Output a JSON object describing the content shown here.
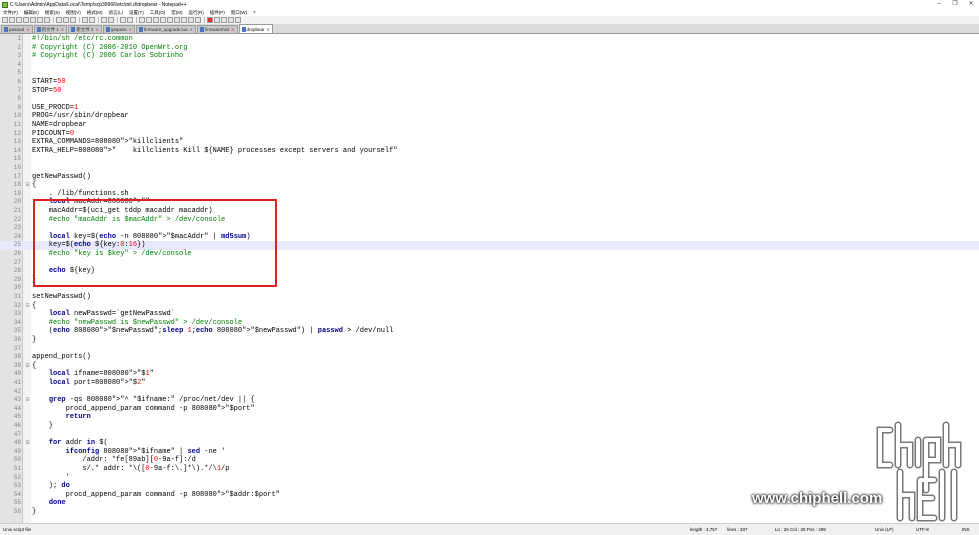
{
  "window": {
    "title": "C:\\Users\\Admin\\AppData\\Local\\Temp\\scp39966\\etc\\init.d\\dropbear - Notepad++",
    "controls": [
      "–",
      "❐",
      "✕"
    ]
  },
  "menu": [
    "文件(F)",
    "编辑(E)",
    "搜索(S)",
    "视图(V)",
    "格式(M)",
    "语言(L)",
    "设置(T)",
    "工具(O)",
    "宏(M)",
    "运行(R)",
    "插件(P)",
    "窗口(W)",
    "?"
  ],
  "tabs": [
    {
      "label": "passwd",
      "active": false
    },
    {
      "label": "新文件 1",
      "active": false
    },
    {
      "label": "新文件 2",
      "active": false
    },
    {
      "label": "getpass",
      "active": false
    },
    {
      "label": "firmware_upgrade.lua",
      "active": false
    },
    {
      "label": "firmwarehist",
      "active": false
    },
    {
      "label": "dropbear",
      "active": true
    }
  ],
  "code_lines": [
    {
      "n": "1",
      "fold": "",
      "text": "#!/bin/sh /etc/rc.common"
    },
    {
      "n": "2",
      "fold": "",
      "text": "# Copyright (C) 2006-2010 OpenWrt.org"
    },
    {
      "n": "3",
      "fold": "",
      "text": "# Copyright (C) 2006 Carlos Sobrinho"
    },
    {
      "n": "4",
      "fold": "",
      "text": ""
    },
    {
      "n": "5",
      "fold": "",
      "text": ""
    },
    {
      "n": "6",
      "fold": "",
      "text": "START=50"
    },
    {
      "n": "7",
      "fold": "",
      "text": "STOP=50"
    },
    {
      "n": "8",
      "fold": "",
      "text": ""
    },
    {
      "n": "9",
      "fold": "",
      "text": "USE_PROCD=1"
    },
    {
      "n": "10",
      "fold": "",
      "text": "PROG=/usr/sbin/dropbear"
    },
    {
      "n": "11",
      "fold": "",
      "text": "NAME=dropbear"
    },
    {
      "n": "12",
      "fold": "",
      "text": "PIDCOUNT=0"
    },
    {
      "n": "13",
      "fold": "",
      "text": "EXTRA_COMMANDS=\"killclients\""
    },
    {
      "n": "14",
      "fold": "",
      "text": "EXTRA_HELP=\"    killclients Kill ${NAME} processes except servers and yourself\""
    },
    {
      "n": "15",
      "fold": "",
      "text": ""
    },
    {
      "n": "16",
      "fold": "",
      "text": ""
    },
    {
      "n": "17",
      "fold": "",
      "text": "getNewPasswd()"
    },
    {
      "n": "18",
      "fold": "⊟",
      "text": "{"
    },
    {
      "n": "19",
      "fold": "",
      "text": "    . /lib/functions.sh"
    },
    {
      "n": "20",
      "fold": "",
      "text": "    local macAddr=\"\""
    },
    {
      "n": "21",
      "fold": "",
      "text": "    macAddr=$(uci_get tddp macaddr macaddr)"
    },
    {
      "n": "22",
      "fold": "",
      "text": "    #echo \"macAddr is $macAddr\" > /dev/console"
    },
    {
      "n": "23",
      "fold": "",
      "text": ""
    },
    {
      "n": "24",
      "fold": "",
      "text": "    local key=$(echo -n \"$macAddr\" | md5sum)"
    },
    {
      "n": "25",
      "fold": "",
      "text": "    key=$(echo ${key:0:16})"
    },
    {
      "n": "26",
      "fold": "",
      "text": "    #echo \"key is $key\" > /dev/console"
    },
    {
      "n": "27",
      "fold": "",
      "text": ""
    },
    {
      "n": "28",
      "fold": "",
      "text": "    echo ${key}"
    },
    {
      "n": "29",
      "fold": "",
      "text": "}"
    },
    {
      "n": "30",
      "fold": "",
      "text": ""
    },
    {
      "n": "31",
      "fold": "",
      "text": "setNewPasswd()"
    },
    {
      "n": "32",
      "fold": "⊟",
      "text": "{"
    },
    {
      "n": "33",
      "fold": "",
      "text": "    local newPasswd=`getNewPasswd`"
    },
    {
      "n": "34",
      "fold": "",
      "text": "    #echo \"newPasswd is $newPasswd\" > /dev/console"
    },
    {
      "n": "35",
      "fold": "",
      "text": "    (echo \"$newPasswd\";sleep 1;echo \"$newPasswd\") | passwd > /dev/null"
    },
    {
      "n": "36",
      "fold": "",
      "text": "}"
    },
    {
      "n": "37",
      "fold": "",
      "text": ""
    },
    {
      "n": "38",
      "fold": "",
      "text": "append_ports()"
    },
    {
      "n": "39",
      "fold": "⊟",
      "text": "{"
    },
    {
      "n": "40",
      "fold": "",
      "text": "    local ifname=\"$1\""
    },
    {
      "n": "41",
      "fold": "",
      "text": "    local port=\"$2\""
    },
    {
      "n": "42",
      "fold": "",
      "text": ""
    },
    {
      "n": "43",
      "fold": "⊟",
      "text": "    grep -qs \"^ *$ifname:\" /proc/net/dev || {"
    },
    {
      "n": "44",
      "fold": "",
      "text": "        procd_append_param command -p \"$port\""
    },
    {
      "n": "45",
      "fold": "",
      "text": "        return"
    },
    {
      "n": "46",
      "fold": "",
      "text": "    }"
    },
    {
      "n": "47",
      "fold": "",
      "text": ""
    },
    {
      "n": "48",
      "fold": "⊟",
      "text": "    for addr in $("
    },
    {
      "n": "49",
      "fold": "",
      "text": "        ifconfig \"$ifname\" | sed -ne '"
    },
    {
      "n": "50",
      "fold": "",
      "text": "            /addr: *fe[89ab][0-9a-f]:/d"
    },
    {
      "n": "51",
      "fold": "",
      "text": "            s/.* addr: *\\([0-9a-f:\\.]*\\).*/\\1/p"
    },
    {
      "n": "52",
      "fold": "",
      "text": "        '"
    },
    {
      "n": "53",
      "fold": "",
      "text": "    ); do"
    },
    {
      "n": "54",
      "fold": "",
      "text": "        procd_append_param command -p \"$addr:$port\""
    },
    {
      "n": "55",
      "fold": "",
      "text": "    done"
    },
    {
      "n": "56",
      "fold": "",
      "text": "}"
    }
  ],
  "current_line": "25",
  "status": {
    "filetype": "Unix script file",
    "length": "length : 4,757",
    "lines": "lines : 207",
    "position": "Ln : 25   Col : 28   Pos : 499",
    "eol": "Unix (LF)",
    "encoding": "UTF-8",
    "mode": "INS"
  },
  "watermark": {
    "site": "www.chiphell.com"
  },
  "colors": {
    "highlight_box": "#e02020",
    "current_line": "#e8e8ff",
    "gutter": "#e4e4e4"
  }
}
